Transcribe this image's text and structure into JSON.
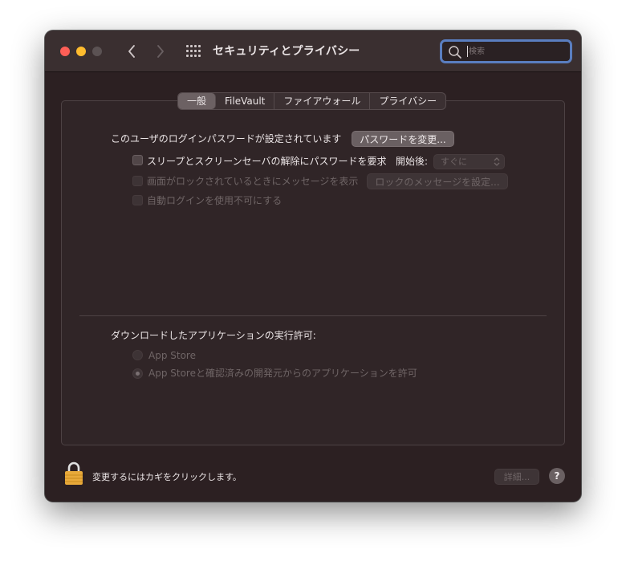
{
  "window": {
    "title": "セキュリティとプライバシー"
  },
  "search": {
    "placeholder": "検索"
  },
  "tabs": [
    {
      "label": "一般",
      "active": true
    },
    {
      "label": "FileVault",
      "active": false
    },
    {
      "label": "ファイアウォール",
      "active": false
    },
    {
      "label": "プライバシー",
      "active": false
    }
  ],
  "general": {
    "password_text": "このユーザのログインパスワードが設定されています",
    "change_password_button": "パスワードを変更...",
    "require_password_label": "スリープとスクリーンセーバの解除にパスワードを要求",
    "start_after_label": "開始後:",
    "start_after_value": "すぐに",
    "lock_message_label": "画面がロックされているときにメッセージを表示",
    "set_lock_message_button": "ロックのメッセージを設定...",
    "auto_login_label": "自動ログインを使用不可にする"
  },
  "downloads": {
    "heading": "ダウンロードしたアプリケーションの実行許可:",
    "options": [
      {
        "label": "App Store",
        "selected": false
      },
      {
        "label": "App Storeと確認済みの開発元からのアプリケーションを許可",
        "selected": true
      }
    ]
  },
  "footer": {
    "lock_text": "変更するにはカギをクリックします。",
    "advanced_button": "詳細...",
    "help_button": "?"
  },
  "colors": {
    "window_bg": "#2c2022",
    "close": "#fe5f57",
    "minimize": "#febc2e",
    "search_focus": "#5a7ec0",
    "lock": "#e8a93a"
  }
}
